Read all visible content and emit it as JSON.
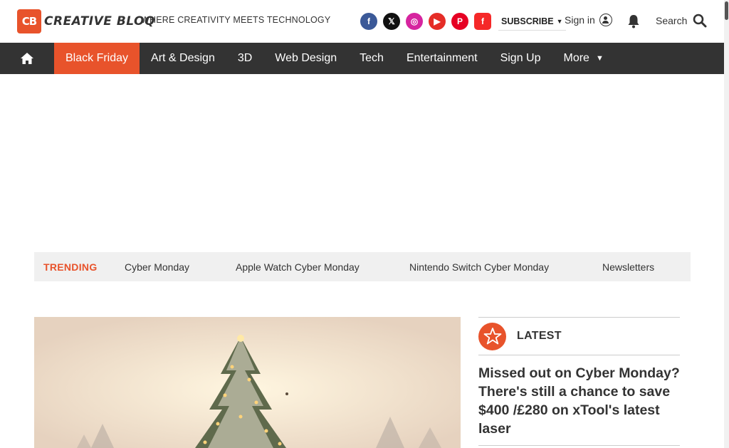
{
  "header": {
    "logo_mark": "CB",
    "logo_word": "CREATIVE BLOQ",
    "tagline": "WHERE CREATIVITY MEETS TECHNOLOGY",
    "socials": [
      {
        "icon": "facebook-icon",
        "glyph": "f"
      },
      {
        "icon": "x-twitter-icon",
        "glyph": "𝕏"
      },
      {
        "icon": "instagram-icon",
        "glyph": "◎"
      },
      {
        "icon": "youtube-icon",
        "glyph": "▶"
      },
      {
        "icon": "pinterest-icon",
        "glyph": "P"
      },
      {
        "icon": "flipboard-icon",
        "glyph": "f"
      }
    ],
    "subscribe_label": "SUBSCRIBE",
    "signin_label": "Sign in",
    "search_label": "Search"
  },
  "nav": {
    "items": [
      {
        "label": "Black Friday",
        "active": true
      },
      {
        "label": "Art & Design"
      },
      {
        "label": "3D"
      },
      {
        "label": "Web Design"
      },
      {
        "label": "Tech"
      },
      {
        "label": "Entertainment"
      },
      {
        "label": "Sign Up"
      },
      {
        "label": "More"
      }
    ]
  },
  "trending": {
    "label": "TRENDING",
    "items": [
      "Cyber Monday",
      "Apple Watch Cyber Monday",
      "Nintendo Switch Cyber Monday",
      "Newsletters"
    ]
  },
  "latest": {
    "label": "LATEST",
    "story": "Missed out on Cyber Monday? There's still a chance to save $400 /£280 on xTool's latest laser"
  },
  "colors": {
    "brand": "#e8532b",
    "nav_bg": "#333333",
    "trending_bg": "#f0f0f0"
  }
}
